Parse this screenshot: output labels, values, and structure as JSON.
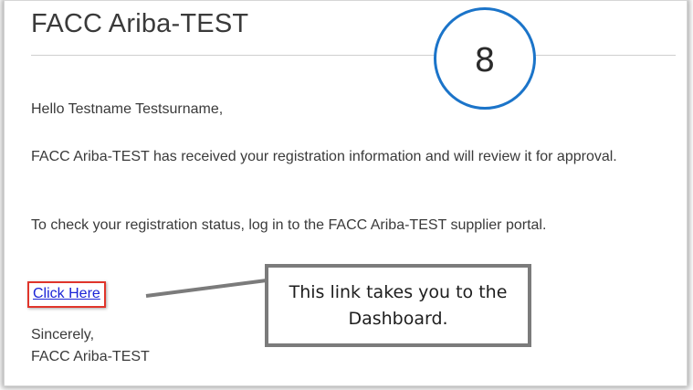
{
  "email": {
    "title": "FACC Ariba-TEST",
    "greeting": "Hello Testname Testsurname,",
    "received_text": "FACC Ariba-TEST has received your registration information and will review it for approval.",
    "check_text": "To check your registration status, log in to the FACC Ariba-TEST supplier portal.",
    "link_label": "Click Here",
    "closing": "Sincerely,",
    "signature": "FACC Ariba-TEST"
  },
  "annotations": {
    "step_number": "8",
    "callout_text": "This link takes you to the Dashboard.",
    "colors": {
      "circle_border": "#1b74c9",
      "link_highlight": "#e0352b",
      "link_text": "#1a23d6",
      "callout_border": "#7b7b7b"
    }
  }
}
